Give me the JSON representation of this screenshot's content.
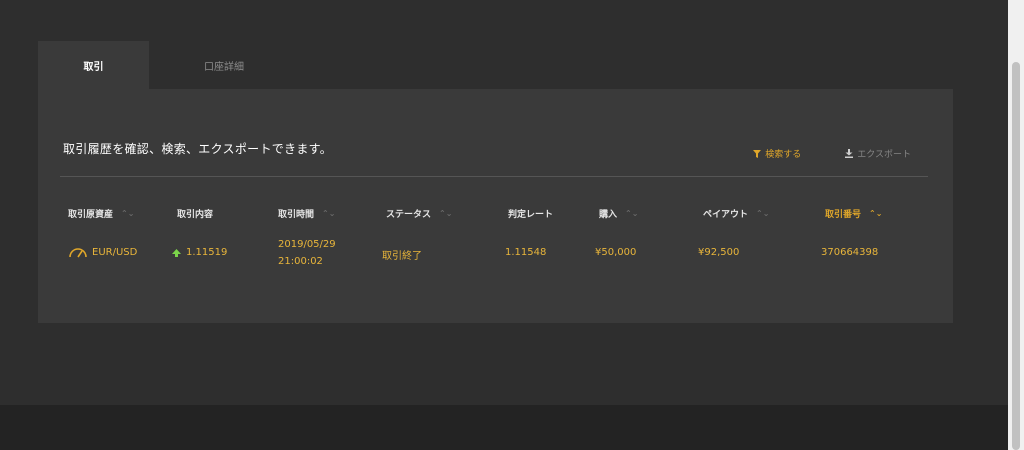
{
  "tabs": [
    {
      "label": "取引",
      "active": true
    },
    {
      "label": "口座詳細",
      "active": false
    }
  ],
  "panel": {
    "description": "取引履歴を確認、検索、エクスポートできます。",
    "search_label": "検索する",
    "export_label": "エクスポート"
  },
  "table": {
    "columns": [
      "取引原資産",
      "取引内容",
      "取引時間",
      "ステータス",
      "判定レート",
      "購入",
      "ペイアウト",
      "取引番号"
    ],
    "rows": [
      {
        "asset": "EUR/USD",
        "trade": "1.11519",
        "time_date": "2019/05/29",
        "time_clock": "21:00:02",
        "status": "取引終了",
        "rate": "1.11548",
        "purchase": "¥50,000",
        "payout": "¥92,500",
        "trade_no": "370664398"
      }
    ]
  },
  "icons": {
    "asset": "gauge-icon",
    "trade_direction": "up-arrow-icon",
    "search": "filter-icon",
    "export": "download-icon"
  },
  "colors": {
    "accent": "#e0a72a",
    "up": "#7bd44a",
    "panel_bg": "#3a3a3a",
    "page_bg": "#2e2e2e"
  }
}
